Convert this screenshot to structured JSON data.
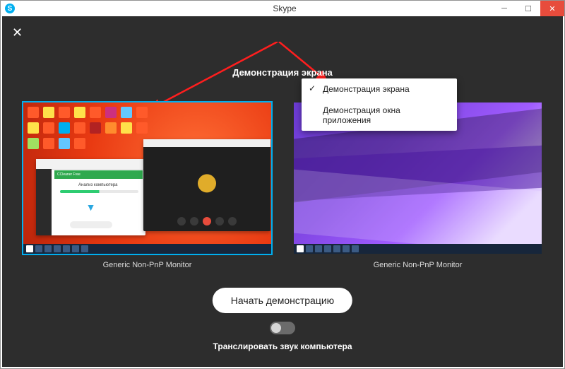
{
  "window": {
    "title": "Skype"
  },
  "dialog": {
    "title": "Демонстрация экрана",
    "menu": {
      "items": [
        {
          "label": "Демонстрация экрана",
          "selected": true
        },
        {
          "label": "Демонстрация окна приложения",
          "selected": false
        }
      ]
    },
    "monitors": [
      {
        "label": "Generic Non-PnP Monitor",
        "selected": true
      },
      {
        "label": "Generic Non-PnP Monitor",
        "selected": false
      }
    ],
    "start_button": "Начать демонстрацию",
    "transmit_audio_label": "Транслировать звук компьютера",
    "transmit_audio_on": false
  },
  "thumb_left": {
    "window_a": {
      "product": "CCleaner Free",
      "heading": "Анализ компьютера"
    }
  },
  "icon_colors": [
    "#ff5a2a",
    "#ffe14a",
    "#ff5a2a",
    "#ffe14a",
    "#ff5a2a",
    "#cc3080",
    "#63c7ff",
    "#ff5a2a",
    "#ffe14a",
    "#ff5a2a",
    "#00aff0",
    "#ff5a2a",
    "#b22222",
    "#ff8c2e",
    "#ffe14a",
    "#ff5a2a",
    "#a0e060",
    "#ff5a2a",
    "#63c7ff",
    "#ff5a2a"
  ]
}
